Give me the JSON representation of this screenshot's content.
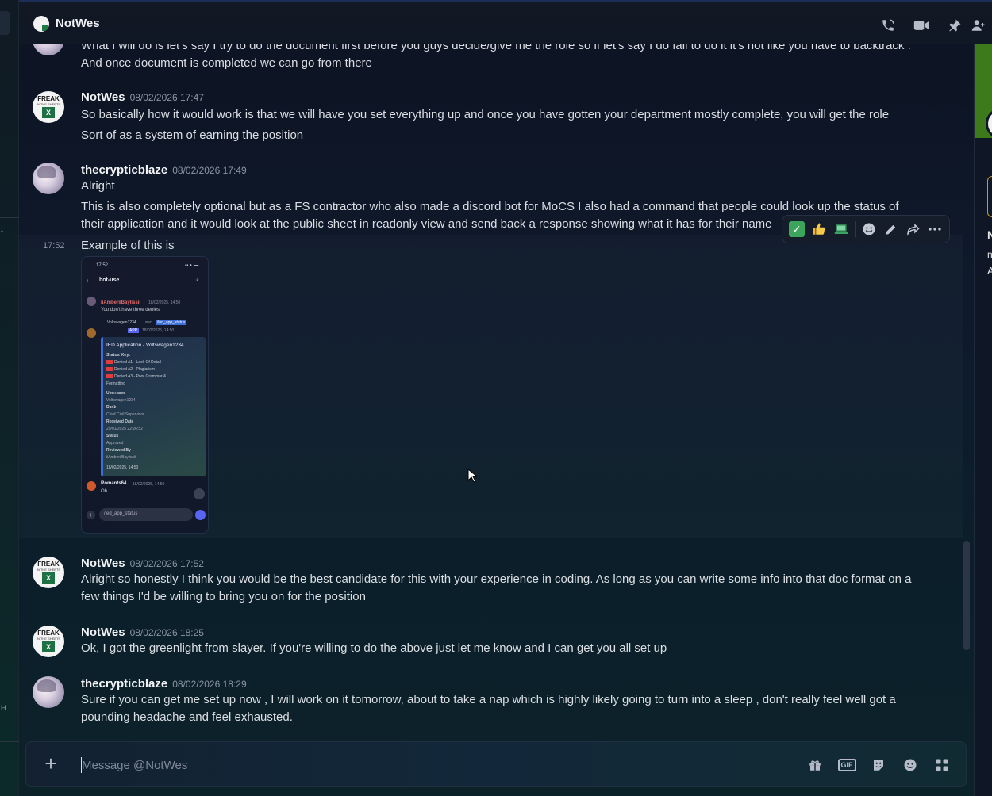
{
  "header": {
    "title": "NotWes",
    "icons": [
      "phone-call-icon",
      "video-camera-icon",
      "pin-icon",
      "add-friends-icon"
    ]
  },
  "messages": [
    {
      "lines": [
        "What I will do is let's say I try to do the document first before you guys decide/give me the role so if let's say I do fail to do it it's not like you have to backtrack .",
        "And once document is completed we can go from there"
      ]
    },
    {
      "author": "NotWes",
      "timestamp": "08/02/2026 17:47",
      "lines": [
        "So basically how it would work is that we will have you set everything up and once you have gotten your department mostly complete, you will get the role",
        "Sort of as a system of earning the position"
      ]
    },
    {
      "author": "thecrypticblaze",
      "timestamp": "08/02/2026 17:49",
      "lines": [
        "Alright",
        "This is also completely optional but as a FS contractor who also made a discord bot for MoCS I also had a command that people could look up the status of",
        "their application and it would look at the public sheet in readonly view and send back a response showing what it has for their name"
      ],
      "followup_time": "17:52",
      "followup_text": "Example of this is"
    },
    {
      "author": "NotWes",
      "timestamp": "08/02/2026 17:52",
      "lines": [
        "Alright so honestly I think you would be the best candidate for this with your experience in coding. As long as you can write some info into that doc format on a",
        "few things I'd be willing to bring you on for the position"
      ]
    },
    {
      "author": "NotWes",
      "timestamp": "08/02/2026 18:25",
      "lines": [
        "Ok, I got the greenlight from slayer. If you're willing to do the above just let me know and I can get you all set up"
      ]
    },
    {
      "author": "thecrypticblaze",
      "timestamp": "08/02/2026 18:29",
      "lines": [
        "Sure if you can get me set up now , I will work on it tomorrow, about to take a nap which is highly likely going to turn into a sleep , don't really feel well got a",
        "pounding headache and feel exhausted."
      ]
    }
  ],
  "attachment": {
    "status_time": "17:52",
    "channel": "bot-use",
    "user1": "iiAmberiiBaylissii",
    "user1_time": "18/02/2025, 14:50",
    "user1_text": "You don't have three denies",
    "user2": "Voltswagen1234",
    "user2_used": "used",
    "command": "/ied_app_status",
    "app_tag": "APP",
    "app_time": "18/02/2025, 14:50",
    "embed_title": "IED Application - Voltswagen1234",
    "status_key": "Status Key:",
    "denied": [
      "Denied A1 - Lack Of Detail",
      "Denied A2 - Plagiarism",
      "Denied A3 - Poor Grammar &",
      "Formatting"
    ],
    "fields": [
      {
        "label": "Username",
        "value": "Voltswagen1234"
      },
      {
        "label": "Rank",
        "value": "Chief Civil Supervisor"
      },
      {
        "label": "Received Date",
        "value": "29/01/2025 22:26:52"
      },
      {
        "label": "Status",
        "value": "Approved"
      },
      {
        "label": "Reviewed By",
        "value": "iiAmberiiBaylissii"
      }
    ],
    "footer_time": "18/02/2025, 14:50",
    "user3": "Romants64",
    "user3_time": "18/02/2025, 14:50",
    "user3_text": "Oh.",
    "input_text": "/ied_app_status"
  },
  "toolbar": {
    "items": [
      "check-reaction",
      "thumbs-up-reaction",
      "computer-reaction",
      "add-reaction-icon",
      "edit-icon",
      "forward-icon",
      "more-icon"
    ]
  },
  "composer": {
    "placeholder": "Message @NotWes",
    "icons": [
      "gift-icon",
      "gif-icon",
      "sticker-icon",
      "emoji-icon",
      "apps-icon"
    ],
    "gif_label": "GIF"
  },
  "right_panel": {
    "letters": [
      "N",
      "n",
      "A"
    ]
  },
  "left_strip": {
    "marks": [
      "-",
      "H"
    ]
  }
}
